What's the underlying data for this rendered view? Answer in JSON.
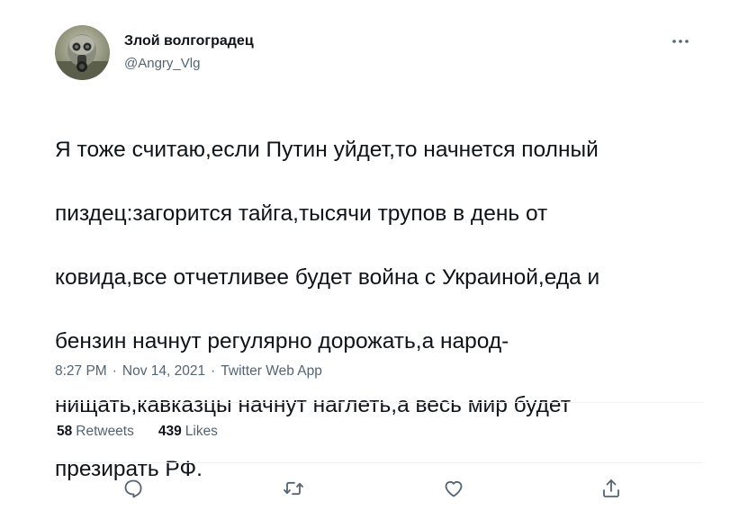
{
  "author": {
    "display_name": "Злой волгоградец",
    "handle": "@Angry_Vlg",
    "avatar_icon": "gas-mask-avatar"
  },
  "tweet": {
    "lines": [
      "Я тоже считаю,если Путин уйдет,то начнется полный",
      "пиздец:загорится тайга,тысячи трупов в день от",
      "ковида,все отчетливее будет война с Украиной,еда и",
      "бензин начнут регулярно дорожать,а народ-",
      "нищать,кавказцы начнут наглеть,а весь мир будет",
      "презирать РФ."
    ]
  },
  "meta": {
    "time": "8:27 PM",
    "date": "Nov 14, 2021",
    "source": "Twitter Web App",
    "separator": "·"
  },
  "stats": {
    "retweets_count": "58",
    "retweets_label": "Retweets",
    "likes_count": "439",
    "likes_label": "Likes"
  },
  "actions": [
    "reply-icon",
    "retweet-icon",
    "like-icon",
    "share-icon"
  ],
  "colors": {
    "text": "#0f1419",
    "secondary": "#536471",
    "divider": "#eff3f4"
  }
}
